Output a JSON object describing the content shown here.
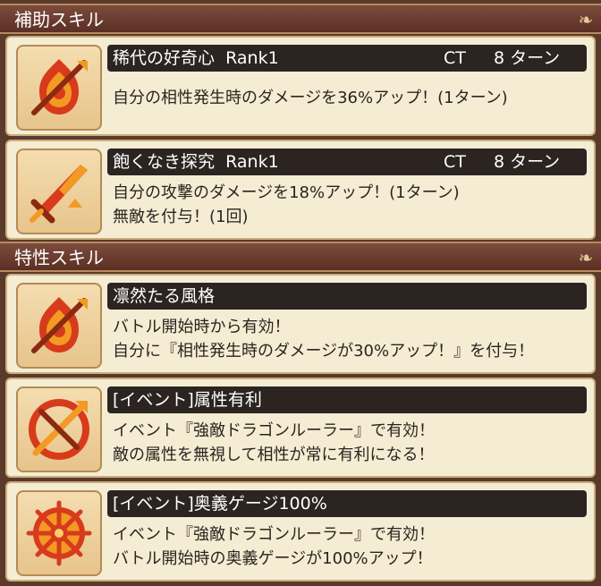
{
  "sections": [
    {
      "title": "補助スキル",
      "icon": "curl-ornament-icon"
    },
    {
      "title": "特性スキル",
      "icon": "curl-ornament-icon"
    }
  ],
  "skills": [
    {
      "name": "稀代の好奇心",
      "rank": "Rank1",
      "ct_label": "CT",
      "ct_value": "8 ターン",
      "icon": "compatibility-up-icon",
      "lines": [
        "自分の相性発生時のダメージを36%アップ！(1ターン)"
      ]
    },
    {
      "name": "飽くなき探究",
      "rank": "Rank1",
      "ct_label": "CT",
      "ct_value": "8 ターン",
      "icon": "attack-up-sword-icon",
      "lines": [
        "自分の攻撃のダメージを18%アップ！(1ターン)",
        "無敵を付与！(1回)"
      ]
    },
    {
      "name": "凛然たる風格",
      "icon": "compatibility-up-icon",
      "lines": [
        "バトル開始時から有効！",
        "自分に『相性発生時のダメージが30%アップ！』を付与！"
      ]
    },
    {
      "name": "[イベント]属性有利",
      "icon": "attribute-advantage-icon",
      "lines": [
        "イベント『強敵ドラゴンルーラー』で有効！",
        "敵の属性を無視して相性が常に有利になる！"
      ]
    },
    {
      "name": "[イベント]奥義ゲージ100%",
      "icon": "special-gauge-icon",
      "lines": [
        "イベント『強敵ドラゴンルーラー』で有効！",
        "バトル開始時の奥義ゲージが100%アップ！"
      ]
    }
  ],
  "colors": {
    "background": "#5a3a2a",
    "card": "#f4edd3",
    "title_bar": "#2b2421",
    "icon_red": "#d83a1c",
    "icon_orange": "#f29a24"
  }
}
